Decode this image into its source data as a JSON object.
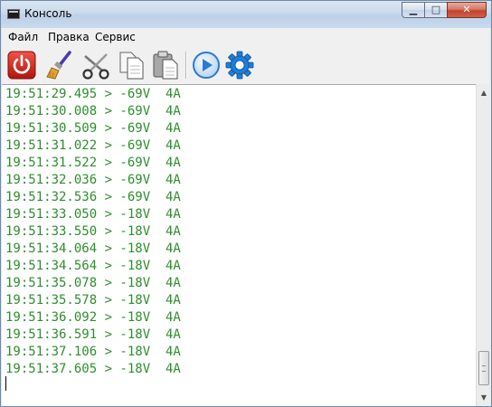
{
  "window": {
    "title": "Консоль",
    "minimize_glyph": "▁",
    "maximize_glyph": "□",
    "close_glyph": "✕"
  },
  "menu": {
    "file": "Файл",
    "edit": "Правка",
    "service": "Сервис"
  },
  "toolbar": {
    "icons": [
      "power-icon",
      "brush-icon",
      "scissors-icon",
      "copy-icon",
      "paste-icon",
      "play-icon",
      "gear-icon"
    ],
    "colors": {
      "power": "#d8261c",
      "play": "#2a7ad0",
      "gear": "#1f7ed6"
    }
  },
  "console": {
    "text_color": "#2d8f2d",
    "lines": [
      "19:51:29.495 > -69V  4A",
      "19:51:30.008 > -69V  4A",
      "19:51:30.509 > -69V  4A",
      "19:51:31.022 > -69V  4A",
      "19:51:31.522 > -69V  4A",
      "19:51:32.036 > -69V  4A",
      "19:51:32.536 > -69V  4A",
      "19:51:33.050 > -18V  4A",
      "19:51:33.550 > -18V  4A",
      "19:51:34.064 > -18V  4A",
      "19:51:34.564 > -18V  4A",
      "19:51:35.078 > -18V  4A",
      "19:51:35.578 > -18V  4A",
      "19:51:36.092 > -18V  4A",
      "19:51:36.591 > -18V  4A",
      "19:51:37.106 > -18V  4A",
      "19:51:37.605 > -18V  4A"
    ]
  },
  "scrollbar": {
    "up_glyph": "▲",
    "down_glyph": "▼"
  }
}
